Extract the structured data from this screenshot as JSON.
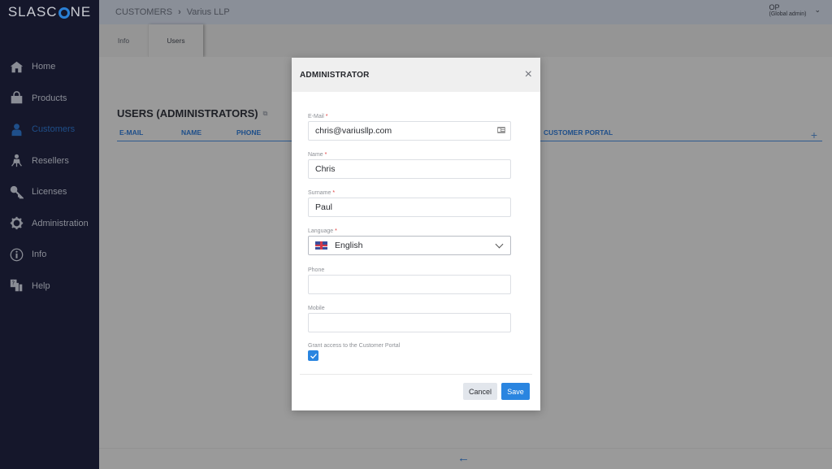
{
  "app": {
    "logo_prefix": "SLASC",
    "logo_suffix": "NE"
  },
  "header": {
    "breadcrumb": [
      "CUSTOMERS",
      "Varius LLP"
    ],
    "user": {
      "name": "OP",
      "role": "(Global admin)"
    }
  },
  "sidebar": {
    "items": [
      {
        "label": "Home",
        "icon": "home-icon",
        "active": false
      },
      {
        "label": "Products",
        "icon": "shopping-bag-icon",
        "active": false
      },
      {
        "label": "Customers",
        "icon": "customer-icon",
        "active": true
      },
      {
        "label": "Resellers",
        "icon": "reseller-icon",
        "active": false
      },
      {
        "label": "Licenses",
        "icon": "key-icon",
        "active": false
      },
      {
        "label": "Administration",
        "icon": "gear-icon",
        "active": false
      },
      {
        "label": "Info",
        "icon": "info-icon",
        "active": false
      },
      {
        "label": "Help",
        "icon": "help-icon",
        "active": false
      }
    ]
  },
  "tabs": [
    {
      "label": "Info",
      "active": false
    },
    {
      "label": "Users",
      "active": true
    }
  ],
  "main": {
    "section_title": "USERS (ADMINISTRATORS)",
    "columns": [
      "E-MAIL",
      "NAME",
      "PHONE",
      "CUSTOMER PORTAL"
    ],
    "add_icon": "+"
  },
  "footer": {
    "back_icon": "←"
  },
  "modal": {
    "title": "ADMINISTRATOR",
    "close_icon": "×",
    "fields": {
      "email": {
        "label": "E-Mail",
        "required": true,
        "value": "chris@variusllp.com"
      },
      "name": {
        "label": "Name",
        "required": true,
        "value": "Chris"
      },
      "surname": {
        "label": "Surname",
        "required": true,
        "value": "Paul"
      },
      "language": {
        "label": "Language",
        "required": true,
        "value": "English"
      },
      "phone": {
        "label": "Phone",
        "required": false,
        "value": ""
      },
      "mobile": {
        "label": "Mobile",
        "required": false,
        "value": ""
      },
      "portal": {
        "label": "Grant access to the Customer Portal",
        "checked": true
      }
    },
    "required_mark": "*",
    "cancel_label": "Cancel",
    "save_label": "Save"
  },
  "colors": {
    "accent": "#2a85e0",
    "sidebar_bg": "#15172b",
    "active_nav": "#1f4f8a",
    "required": "#e03a3a"
  }
}
